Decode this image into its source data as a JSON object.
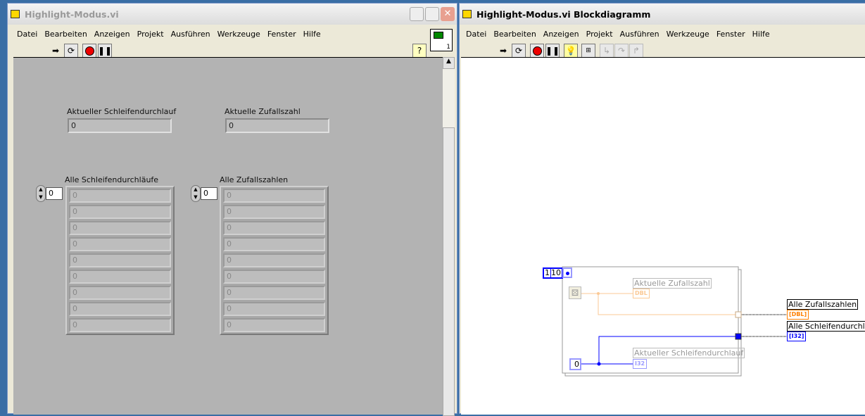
{
  "front_panel": {
    "title": "Highlight-Modus.vi",
    "menu": [
      "Datei",
      "Bearbeiten",
      "Anzeigen",
      "Projekt",
      "Ausführen",
      "Werkzeuge",
      "Fenster",
      "Hilfe"
    ],
    "toolbar": {
      "run": "run-arrow-icon",
      "run_continuously": "run-continuously-icon",
      "abort": "abort-icon",
      "pause": "pause-icon",
      "help": "?"
    },
    "connector_pane_number": "1",
    "indicators": [
      {
        "label": "Aktueller Schleifendurchlauf",
        "value": "0"
      },
      {
        "label": "Aktuelle Zufallszahl",
        "value": "0"
      }
    ],
    "arrays": [
      {
        "label": "Alle Schleifendurchläufe",
        "index": "0",
        "elements": [
          "0",
          "0",
          "0",
          "0",
          "0",
          "0",
          "0",
          "0",
          "0"
        ]
      },
      {
        "label": "Alle Zufallszahlen",
        "index": "0",
        "elements": [
          "0",
          "0",
          "0",
          "0",
          "0",
          "0",
          "0",
          "0",
          "0"
        ]
      }
    ]
  },
  "block_diagram": {
    "title": "Highlight-Modus.vi Blockdiagramm",
    "menu": [
      "Datei",
      "Bearbeiten",
      "Anzeigen",
      "Projekt",
      "Ausführen",
      "Werkzeuge",
      "Fenster",
      "Hilfe"
    ],
    "loop_count_constant": "10",
    "loop_count_prefix": "1",
    "n_terminal": "N",
    "shift_init": "0",
    "terminals": {
      "current_random": {
        "label": "Aktuelle Zufallszahl",
        "type": "DBL"
      },
      "current_iteration": {
        "label": "Aktueller Schleifendurchlauf",
        "type": "I32"
      },
      "all_random": {
        "label": "Alle Zufallszahlen",
        "type": "[DBL]"
      },
      "all_iterations": {
        "label": "Alle Schleifendurchläufe",
        "type": "[I32]"
      }
    }
  },
  "colors": {
    "dbl": "#ff8000",
    "i32": "#0000ff",
    "panel": "#b3b3b3"
  }
}
